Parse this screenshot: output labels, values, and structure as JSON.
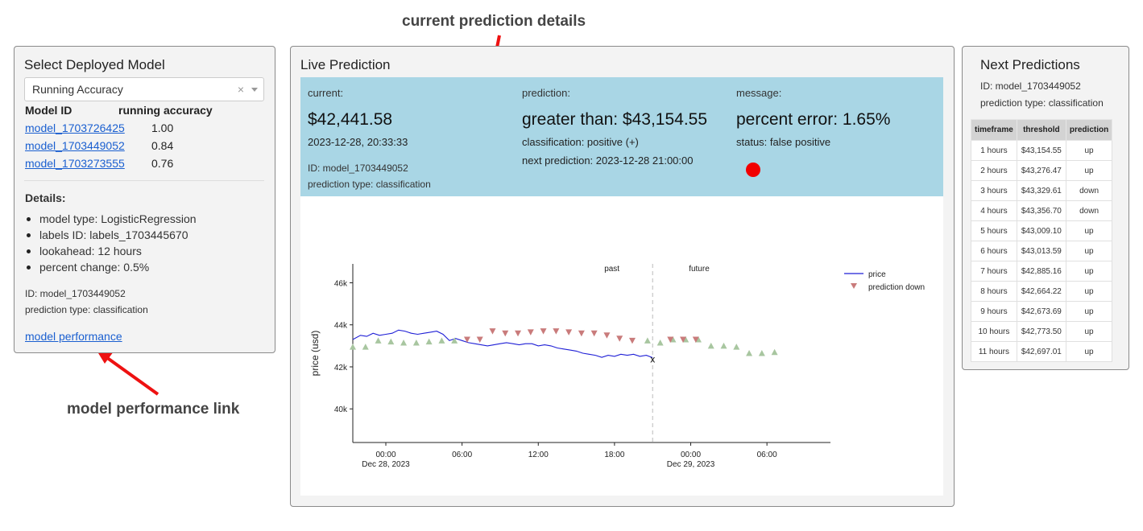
{
  "annotations": {
    "top": "current prediction details",
    "bottom": "model performance link"
  },
  "left_panel": {
    "title": "Select Deployed Model",
    "select": {
      "value": "Running Accuracy",
      "clear": "×"
    },
    "table": {
      "headers": [
        "Model ID",
        "running accuracy"
      ],
      "rows": [
        {
          "id": "model_1703726425",
          "accuracy": "1.00"
        },
        {
          "id": "model_1703449052",
          "accuracy": "0.84"
        },
        {
          "id": "model_1703273555",
          "accuracy": "0.76"
        }
      ]
    },
    "details_label": "Details:",
    "details": [
      "model type: LogisticRegression",
      "labels ID: labels_1703445670",
      "lookahead: 12 hours",
      "percent change: 0.5%"
    ],
    "id_line": "ID: model_1703449052",
    "type_line": "prediction type: classification",
    "performance_link": "model performance"
  },
  "center_panel": {
    "title": "Live Prediction",
    "current": {
      "label": "current:",
      "price": "$42,441.58",
      "timestamp": "2023-12-28, 20:33:33",
      "id_line": "ID: model_1703449052",
      "type_line": "prediction type: classification"
    },
    "prediction": {
      "label": "prediction:",
      "value": "greater than: $43,154.55",
      "classification": "classification: positive (+)",
      "next": "next prediction: 2023-12-28 21:00:00"
    },
    "message": {
      "label": "message:",
      "value": "percent error: 1.65%",
      "status": "status: false positive",
      "status_color": "#f20000"
    },
    "colors": {
      "info_bg": "#a9d6e5"
    }
  },
  "chart_data": {
    "type": "line",
    "ylabel": "price (usd)",
    "ylim": [
      38400,
      46900
    ],
    "y_ticks": [
      {
        "value": 40000,
        "label": "40k"
      },
      {
        "value": 42000,
        "label": "42k"
      },
      {
        "value": 44000,
        "label": "44k"
      },
      {
        "value": 46000,
        "label": "46k"
      }
    ],
    "xlim": [
      -2.6,
      35
    ],
    "x_unit": "hours since 2023-12-28 00:00",
    "x_ticks": [
      {
        "value": 0,
        "label": "00:00",
        "sub": "Dec 28, 2023"
      },
      {
        "value": 6,
        "label": "06:00",
        "sub": ""
      },
      {
        "value": 12,
        "label": "12:00",
        "sub": ""
      },
      {
        "value": 18,
        "label": "18:00",
        "sub": ""
      },
      {
        "value": 24,
        "label": "00:00",
        "sub": "Dec 29, 2023"
      },
      {
        "value": 30,
        "label": "06:00",
        "sub": ""
      }
    ],
    "divider_x": 21.0,
    "region_labels": {
      "past": "past",
      "future": "future"
    },
    "current_marker": {
      "x": 21.0,
      "y": 42440,
      "label": "x"
    },
    "legend": {
      "position": "top-right",
      "price": "price",
      "prediction_down": "prediction down"
    },
    "colors": {
      "price": "#1f1fd6",
      "up": "#a8c6a0",
      "down": "#c97b7b"
    },
    "series": [
      {
        "name": "price",
        "x": [
          -2.6,
          -2.0,
          -1.5,
          -1.0,
          -0.5,
          0.0,
          0.5,
          1.0,
          1.5,
          2.0,
          2.5,
          3.0,
          3.5,
          4.0,
          4.5,
          5.0,
          5.5,
          6.0,
          6.5,
          7.0,
          7.5,
          8.0,
          8.5,
          9.0,
          9.5,
          10.0,
          10.5,
          11.0,
          11.5,
          12.0,
          12.5,
          13.0,
          13.5,
          14.0,
          14.5,
          15.0,
          15.5,
          16.0,
          16.5,
          17.0,
          17.5,
          18.0,
          18.5,
          19.0,
          19.5,
          20.0,
          20.5,
          21.0
        ],
        "values": [
          43300,
          43500,
          43450,
          43600,
          43500,
          43550,
          43600,
          43750,
          43700,
          43600,
          43550,
          43600,
          43650,
          43700,
          43550,
          43250,
          43350,
          43250,
          43150,
          43100,
          43050,
          43000,
          43050,
          43100,
          43150,
          43100,
          43050,
          43100,
          43100,
          43000,
          43050,
          43000,
          42900,
          42850,
          42800,
          42750,
          42650,
          42600,
          42550,
          42450,
          42550,
          42500,
          42600,
          42550,
          42600,
          42500,
          42550,
          42440
        ]
      },
      {
        "name": "prediction up",
        "x": [
          -2.6,
          -1.6,
          -0.6,
          0.4,
          1.4,
          2.4,
          3.4,
          4.4,
          5.4,
          20.6,
          21.6,
          22.6,
          23.6,
          24.6,
          25.6,
          26.6,
          27.6,
          28.6,
          29.6,
          30.6
        ],
        "values": [
          42950,
          42950,
          43250,
          43200,
          43150,
          43150,
          43200,
          43250,
          43250,
          43250,
          43150,
          43300,
          43300,
          43300,
          43000,
          43000,
          42950,
          42650,
          42650,
          42700
        ]
      },
      {
        "name": "prediction down",
        "x": [
          6.4,
          7.4,
          8.4,
          9.4,
          10.4,
          11.4,
          12.4,
          13.4,
          14.4,
          15.4,
          16.4,
          17.4,
          18.4,
          19.4,
          22.4,
          23.4,
          24.4
        ],
        "values": [
          43300,
          43300,
          43700,
          43600,
          43600,
          43650,
          43700,
          43700,
          43650,
          43600,
          43600,
          43500,
          43350,
          43250,
          43300,
          43300,
          43300
        ]
      }
    ]
  },
  "right_panel": {
    "title": "Next Predictions",
    "id_line": "ID: model_1703449052",
    "type_line": "prediction type: classification",
    "table": {
      "headers": [
        "timeframe",
        "threshold",
        "prediction"
      ],
      "rows": [
        [
          "1 hours",
          "$43,154.55",
          "up"
        ],
        [
          "2 hours",
          "$43,276.47",
          "up"
        ],
        [
          "3 hours",
          "$43,329.61",
          "down"
        ],
        [
          "4 hours",
          "$43,356.70",
          "down"
        ],
        [
          "5 hours",
          "$43,009.10",
          "up"
        ],
        [
          "6 hours",
          "$43,013.59",
          "up"
        ],
        [
          "7 hours",
          "$42,885.16",
          "up"
        ],
        [
          "8 hours",
          "$42,664.22",
          "up"
        ],
        [
          "9 hours",
          "$42,673.69",
          "up"
        ],
        [
          "10 hours",
          "$42,773.50",
          "up"
        ],
        [
          "11 hours",
          "$42,697.01",
          "up"
        ]
      ]
    }
  }
}
